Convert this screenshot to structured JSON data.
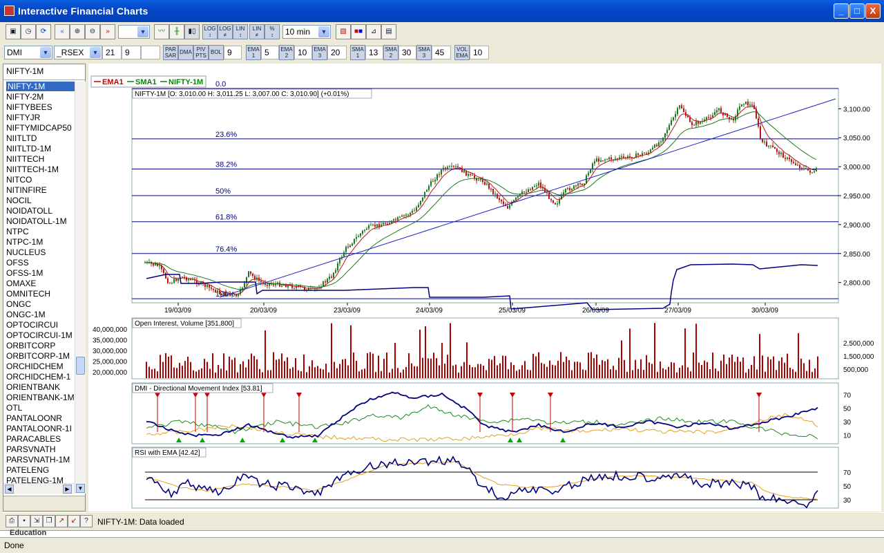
{
  "window": {
    "title": "Interactive Financial Charts",
    "min": "_",
    "max": "□",
    "close": "X"
  },
  "toolbar1": {
    "interval_value": "10 min",
    "blank_select": ""
  },
  "toolbar2": {
    "indicator": "DMI",
    "index": "_RSEX",
    "p1": "21",
    "p2": "9",
    "p3": "",
    "bol": "9",
    "ema1": "5",
    "ema2": "10",
    "ema3": "20",
    "sma1": "13",
    "sma2": "30",
    "sma3": "45",
    "volema": "10"
  },
  "list": {
    "header": "NIFTY-1M",
    "selected": "NIFTY-1M",
    "items": [
      "NIFTY-1M",
      "NIFTY-2M",
      "NIFTYBEES",
      "NIFTYJR",
      "NIFTYMIDCAP50",
      "NIITLTD",
      "NIITLTD-1M",
      "NIITTECH",
      "NIITTECH-1M",
      "NITCO",
      "NITINFIRE",
      "NOCIL",
      "NOIDATOLL",
      "NOIDATOLL-1M",
      "NTPC",
      "NTPC-1M",
      "NUCLEUS",
      "OFSS",
      "OFSS-1M",
      "OMAXE",
      "OMNITECH",
      "ONGC",
      "ONGC-1M",
      "OPTOCIRCUI",
      "OPTOCIRCUI-1M",
      "ORBITCORP",
      "ORBITCORP-1M",
      "ORCHIDCHEM",
      "ORCHIDCHEM-1",
      "ORIENTBANK",
      "ORIENTBANK-1M",
      "OTL",
      "PANTALOONR",
      "PANTALOONR-1I",
      "PARACABLES",
      "PARSVNATH",
      "PARSVNATH-1M",
      "PATELENG",
      "PATELENG-1M"
    ]
  },
  "legend": [
    {
      "name": "EMA1",
      "color": "#cc0000"
    },
    {
      "name": "SMA1",
      "color": "#008800"
    },
    {
      "name": "NIFTY-1M",
      "color": "#008800"
    }
  ],
  "main_chart": {
    "title": "NIFTY-1M [O: 3,010.00  H: 3,011.25  L: 3,007.00  C: 3,010.90] (+0.01%)",
    "fib_top": "0.0",
    "fib_bottom": "100%",
    "fib_levels": [
      "23.6%",
      "38.2%",
      "50%",
      "61.8%",
      "76.4%"
    ],
    "y_ticks": [
      "3,100.00",
      "3,050.00",
      "3,000.00",
      "2,950.00",
      "2,900.00",
      "2,850.00",
      "2,800.00"
    ],
    "x_ticks": [
      "19/03/09",
      "20/03/09",
      "23/03/09",
      "24/03/09",
      "25/03/09",
      "26/03/09",
      "27/03/09",
      "30/03/09"
    ]
  },
  "volume_chart": {
    "title": "Open Interest, Volume [351,800]",
    "left_ticks": [
      "40,000,000",
      "35,000,000",
      "30,000,000",
      "25,000,000",
      "20,000,000"
    ],
    "right_ticks": [
      "2,500,000",
      "1,500,000",
      "500,000"
    ]
  },
  "dmi_chart": {
    "title": "DMI - Directional Movement Index [53.81]",
    "y_ticks": [
      "70",
      "50",
      "30",
      "10"
    ]
  },
  "rsi_chart": {
    "title": "RSI with EMA [42.42]",
    "y_ticks": [
      "70",
      "50",
      "30"
    ]
  },
  "status": {
    "message": "NIFTY-1M: Data loaded"
  },
  "footer": {
    "text": "Done",
    "behind": "Education"
  },
  "colors": {
    "up": "#1a7a1a",
    "down": "#b41414",
    "fib_line": "#000080",
    "volume": "#aa0000",
    "oi": "#000080",
    "dmi_adx": "#000080",
    "dmi_plus": "#1a8a1a",
    "dmi_minus": "#e0a020",
    "rsi": "#000080",
    "rsi_ema": "#e0a020"
  }
}
